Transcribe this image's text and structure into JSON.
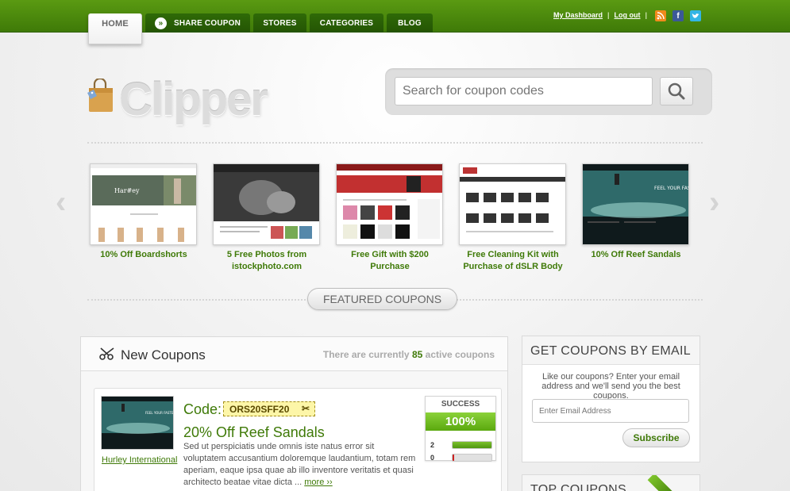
{
  "nav": {
    "tabs": [
      {
        "label": "HOME"
      },
      {
        "label": "SHARE COUPON"
      },
      {
        "label": "STORES"
      },
      {
        "label": "CATEGORIES"
      },
      {
        "label": "BLOG"
      }
    ],
    "links": {
      "dashboard": "My Dashboard",
      "sep": "|",
      "logout": "Log out"
    }
  },
  "logo": {
    "text": "Clipper"
  },
  "search": {
    "placeholder": "Search for coupon codes"
  },
  "slider": {
    "items": [
      {
        "caption": "10% Off Boardshorts"
      },
      {
        "caption": "5 Free Photos from istockphoto.com"
      },
      {
        "caption": "Free Gift with $200 Purchase"
      },
      {
        "caption": "Free Cleaning Kit with Purchase of dSLR Body"
      },
      {
        "caption": "10% Off Reef Sandals"
      }
    ]
  },
  "featured": {
    "label": "FEATURED COUPONS"
  },
  "new_coupons": {
    "title": "New Coupons",
    "status_prefix": "There are currently",
    "count": "85",
    "status_suffix": "active coupons",
    "coupon": {
      "store": "Hurley International",
      "code_label": "Code:",
      "code": "ORS20SFF20",
      "title": "20% Off Reef Sandals",
      "description": "Sed ut perspiciatis unde omnis iste natus error sit voluptatem accusantium doloremque laudantium, totam rem aperiam, eaque ipsa quae ab illo inventore veritatis et quasi architecto beatae vitae dicta ...",
      "more": "more ››",
      "success_label": "SUCCESS",
      "success_pct": "100%",
      "votes_up": "2",
      "votes_down": "0",
      "votes_up_fraction": 1.0,
      "votes_down_fraction": 0.0
    }
  },
  "email_signup": {
    "title": "GET COUPONS BY EMAIL",
    "text": "Like our coupons? Enter your email address and we'll send you the best coupons.",
    "placeholder": "Enter Email Address",
    "button": "Subscribe"
  },
  "top_coupons": {
    "title": "TOP COUPONS"
  },
  "colors": {
    "brand_green": "#3f7a08",
    "bar_green": "#5a9a12",
    "code_yellow": "#fdf6a8"
  }
}
